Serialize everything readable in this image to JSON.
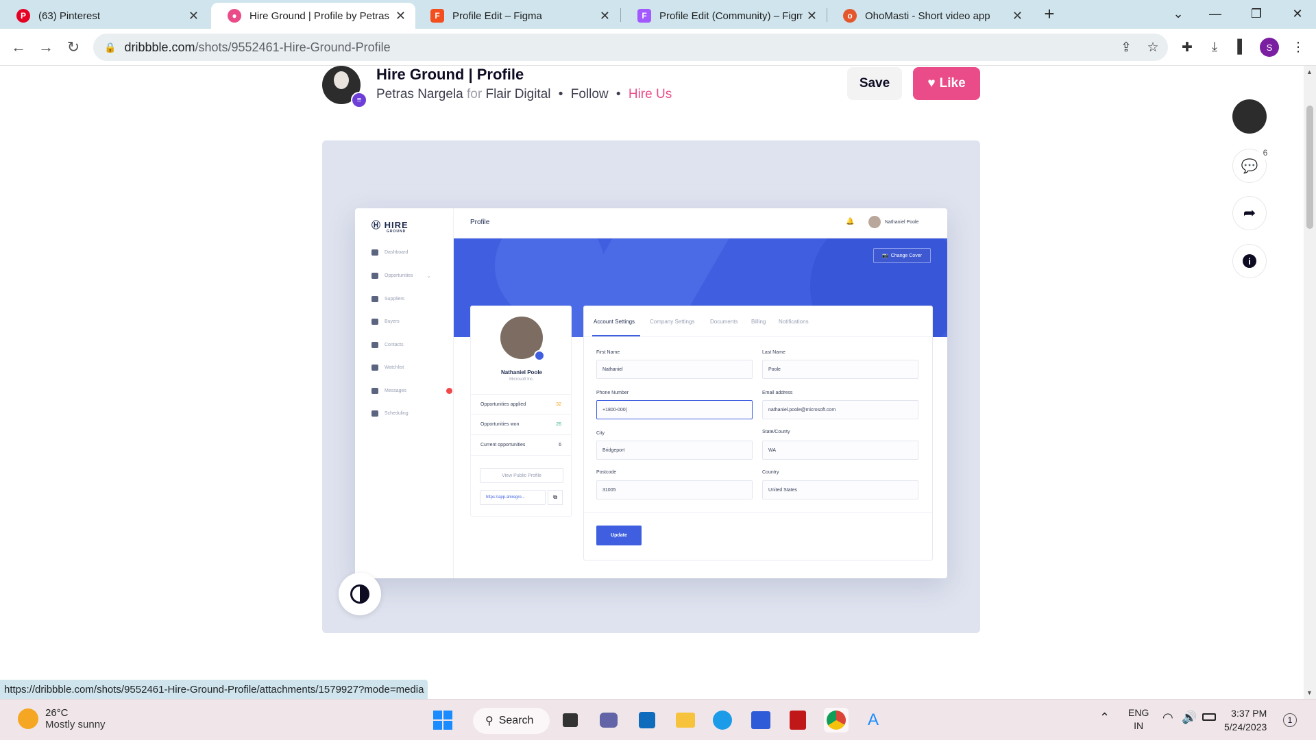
{
  "tabs": [
    {
      "title": "(63) Pinterest",
      "icon": "pinterest-icon",
      "color": "#e60023"
    },
    {
      "title": "Hire Ground | Profile by Petras Nargela",
      "icon": "dribbble-icon",
      "color": "#ea4c89"
    },
    {
      "title": "Profile Edit – Figma",
      "icon": "figma-icon",
      "color": "#f24e1e"
    },
    {
      "title": "Profile Edit (Community) – Figma",
      "icon": "figma-icon",
      "color": "#f24e1e"
    },
    {
      "title": "OhoMasti - Short video app",
      "icon": "ohomasti-icon",
      "color": "#e4572e"
    }
  ],
  "address": {
    "domain": "dribbble.com",
    "path": "/shots/9552461-Hire-Ground-Profile"
  },
  "profile_avatar_letter": "S",
  "shot": {
    "title": "Hire Ground | Profile",
    "author": "Petras Nargela",
    "for_word": "for",
    "team": "Flair Digital",
    "dot": "•",
    "follow": "Follow",
    "hire": "Hire Us",
    "save_label": "Save",
    "like_label": "Like",
    "comments_count": "6"
  },
  "mock": {
    "logo": "HIRE",
    "logo_sub": "GROUND",
    "page_title": "Profile",
    "user_name": "Nathaniel Poole",
    "change_cover": "Change Cover",
    "nav": [
      "Dashboard",
      "Opportunities",
      "Suppliers",
      "Buyers",
      "Contacts",
      "Watchlist",
      "Messages",
      "Scheduling"
    ],
    "card_name": "Nathaniel Poole",
    "card_company": "Microsoft Inc.",
    "stats": [
      {
        "label": "Opportunities applied",
        "value": "32",
        "color": "#f5a623"
      },
      {
        "label": "Opportunities won",
        "value": "26",
        "color": "#36b37e"
      },
      {
        "label": "Current opportunities",
        "value": "6",
        "color": "#3a425a"
      }
    ],
    "view_public": "View Public Profile",
    "public_url": "https://app.ahiregro...",
    "tabs": [
      "Account Settings",
      "Company Settings",
      "Documents",
      "Billing",
      "Notifications"
    ],
    "fields": {
      "first_name_label": "First Name",
      "first_name": "Nathaniel",
      "last_name_label": "Last Name",
      "last_name": "Poole",
      "phone_label": "Phone Number",
      "phone": "+1800-000|",
      "email_label": "Email address",
      "email": "nathaniel.poole@microsoft.com",
      "city_label": "City",
      "city": "Bridgeport",
      "state_label": "State/County",
      "state": "WA",
      "postcode_label": "Postcode",
      "postcode": "31005",
      "country_label": "Country",
      "country": "United States"
    },
    "update_label": "Update"
  },
  "status_url": "https://dribbble.com/shots/9552461-Hire-Ground-Profile/attachments/1579927?mode=media",
  "taskbar": {
    "temp": "26°C",
    "weather": "Mostly sunny",
    "search": "Search",
    "lang1": "ENG",
    "lang2": "IN",
    "time": "3:37 PM",
    "date": "5/24/2023",
    "notif_count": "1"
  }
}
